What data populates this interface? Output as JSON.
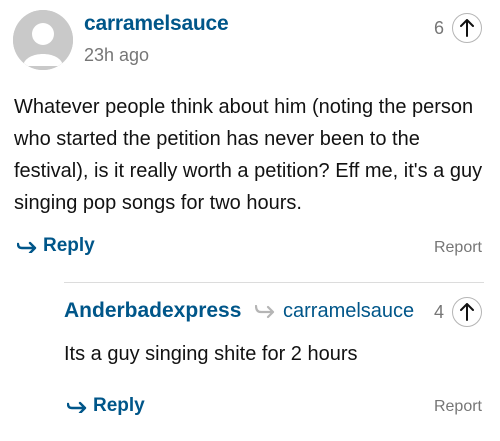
{
  "comment": {
    "author": "carramelsauce",
    "timestamp": "23h ago",
    "recommend_count": "6",
    "body": "Whatever people think about him (noting the person who started the petition has never been to the festival), is it really worth a petition? Eff me, it's a guy singing pop songs for two hours.",
    "reply_label": "Reply",
    "report_label": "Report",
    "avatar_icon": "default-avatar-icon"
  },
  "reply": {
    "author": "Anderbadexpress",
    "in_reply_to": "carramelsauce",
    "recommend_count": "4",
    "body": "Its a guy singing shite for 2 hours",
    "reply_label": "Reply",
    "report_label": "Report"
  },
  "colors": {
    "accent": "#005689",
    "muted": "#767676",
    "text": "#121212",
    "avatar": "#c9c9c9"
  }
}
